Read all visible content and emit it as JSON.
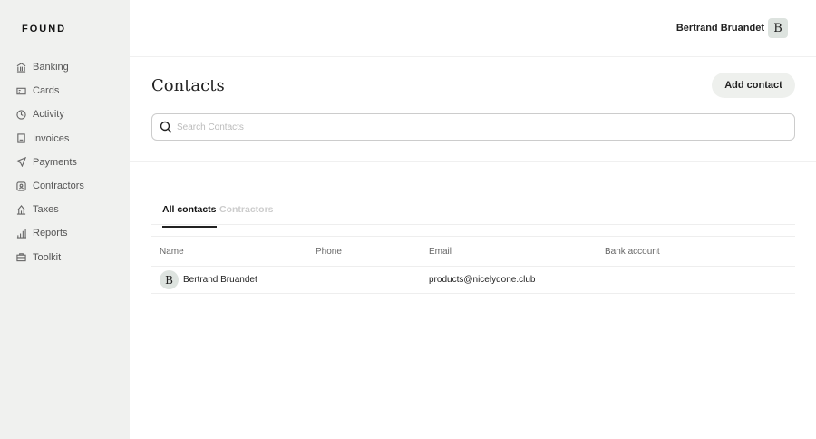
{
  "brand": "FOUND",
  "sidebar": {
    "items": [
      {
        "label": "Banking",
        "icon": "bank-icon"
      },
      {
        "label": "Cards",
        "icon": "card-icon"
      },
      {
        "label": "Activity",
        "icon": "clock-icon"
      },
      {
        "label": "Invoices",
        "icon": "invoice-icon"
      },
      {
        "label": "Payments",
        "icon": "send-icon"
      },
      {
        "label": "Contractors",
        "icon": "contractor-icon"
      },
      {
        "label": "Taxes",
        "icon": "building-icon"
      },
      {
        "label": "Reports",
        "icon": "chart-icon"
      },
      {
        "label": "Toolkit",
        "icon": "briefcase-icon"
      }
    ]
  },
  "header": {
    "user_name": "Bertrand Bruandet",
    "avatar_letter": "B"
  },
  "page": {
    "title": "Contacts",
    "add_label": "Add contact",
    "search_placeholder": "Search Contacts"
  },
  "tabs": [
    {
      "label": "All contacts"
    },
    {
      "label": "Contractors"
    }
  ],
  "table": {
    "headers": [
      "Name",
      "Phone",
      "Email",
      "Bank account"
    ],
    "rows": [
      {
        "avatar": "B",
        "name": "Bertrand Bruandet",
        "phone": "",
        "email": "products@nicelydone.club",
        "bank": ""
      }
    ]
  }
}
